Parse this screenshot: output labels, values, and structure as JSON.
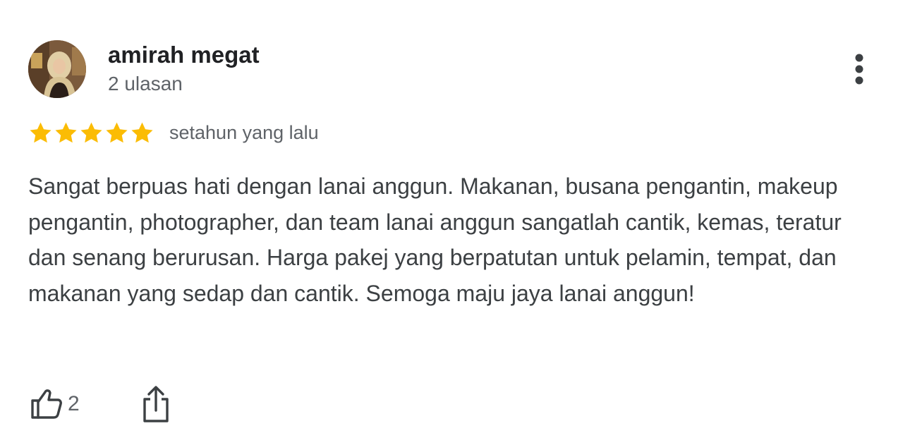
{
  "reviewer": {
    "name": "amirah megat",
    "review_count": "2 ulasan"
  },
  "rating": {
    "stars": 5,
    "max": 5,
    "time": "setahun yang lalu"
  },
  "review": {
    "text": "Sangat berpuas hati dengan lanai anggun. Makanan, busana pengantin, makeup pengantin, photographer, dan team lanai anggun sangatlah cantik, kemas, teratur dan senang berurusan. Harga pakej yang berpatutan untuk pelamin, tempat, dan makanan yang sedap dan cantik. Semoga maju jaya lanai anggun!"
  },
  "actions": {
    "like_count": "2"
  },
  "icons": {
    "star": "star-icon",
    "more": "more-vert-icon",
    "like": "thumb-up-icon",
    "share": "share-icon"
  },
  "colors": {
    "star": "#FBBC04",
    "icon": "#3c4043",
    "secondary_text": "#5f6368"
  }
}
